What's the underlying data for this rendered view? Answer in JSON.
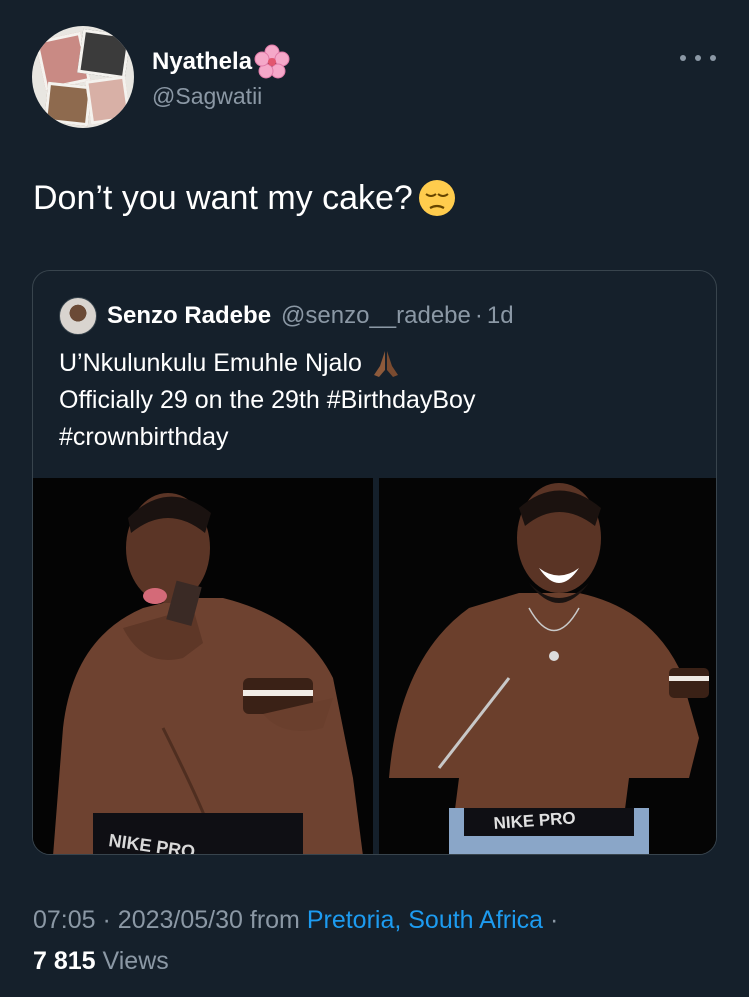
{
  "author": {
    "display_name": "Nyathela",
    "handle": "@Sagwatii",
    "name_emoji_icon": "cherry-blossom-icon"
  },
  "tweet": {
    "text": "Don’t you want my cake?",
    "emoji_icon": "pensive-face-icon"
  },
  "quoted": {
    "name": "Senzo Radebe",
    "handle": "@senzo__radebe",
    "separator": "·",
    "time": "1d",
    "line1": "U’Nkulunkulu Emuhle Njalo",
    "line1_emoji_icon": "folded-hands-icon",
    "line2": "Officially 29 on the 29th #BirthdayBoy",
    "line3": "#crownbirthday",
    "media": [
      {
        "label": "NIKE PRO"
      },
      {
        "label": "NIKE PRO"
      }
    ]
  },
  "footer": {
    "time": "07:05",
    "separator": "·",
    "date": "2023/05/30",
    "from": "from",
    "place": "Pretoria, South Africa",
    "trailing_separator": "·",
    "views_count": "7 815",
    "views_label": "Views"
  },
  "colors": {
    "background": "#15202b",
    "text": "#ffffff",
    "secondary": "#8b98a5",
    "link": "#1d9bf0",
    "border": "#38444d"
  }
}
